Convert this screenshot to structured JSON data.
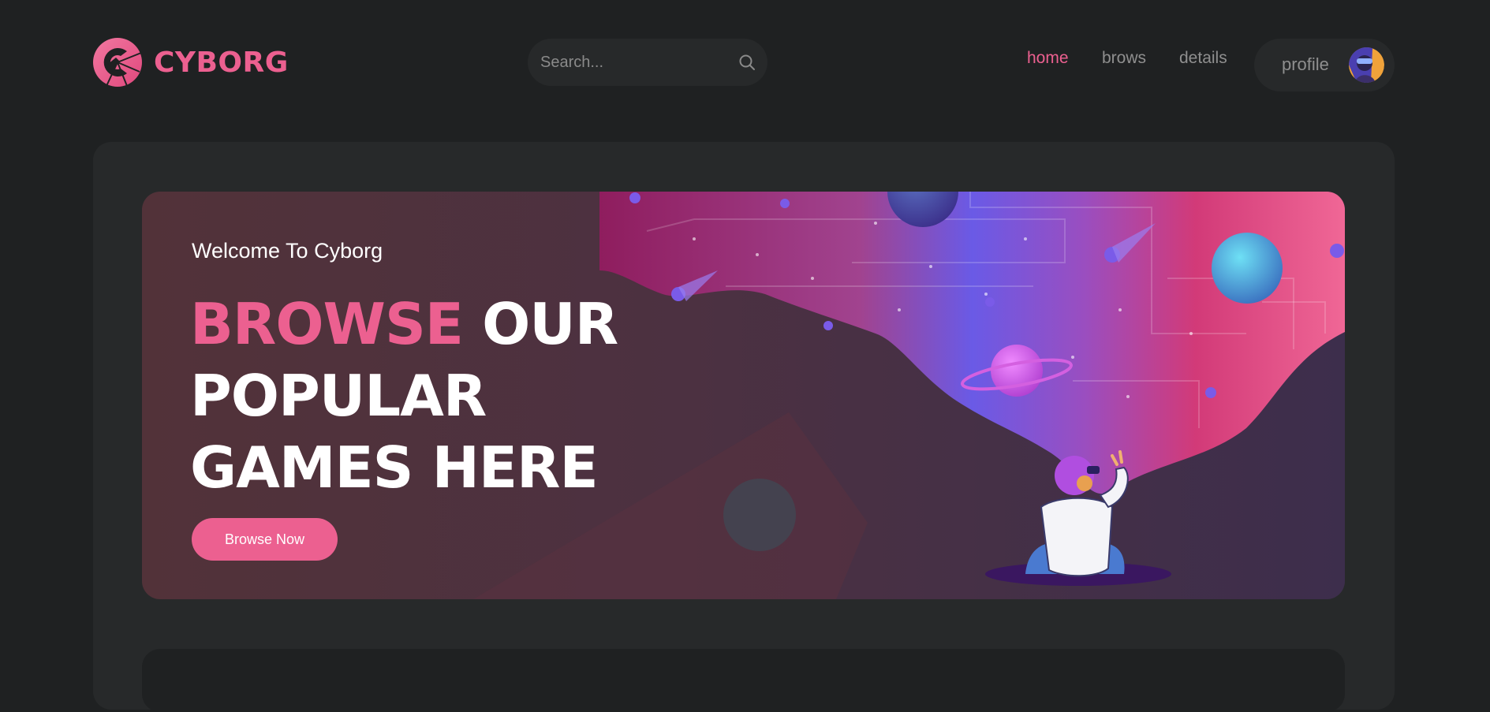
{
  "brand": {
    "name": "CYBORG",
    "accent": "#ec6090"
  },
  "search": {
    "placeholder": "Search...",
    "value": ""
  },
  "nav": {
    "items": [
      {
        "label": "home",
        "active": true
      },
      {
        "label": "brows",
        "active": false
      },
      {
        "label": "details",
        "active": false
      }
    ],
    "profile_label": "profile"
  },
  "banner": {
    "welcome": "Welcome To Cyborg",
    "headline_highlight": "BROWSE",
    "headline_rest_1": "OUR",
    "headline_line_2": "POPULAR",
    "headline_line_3": "GAMES HERE",
    "button_label": "Browse Now"
  },
  "colors": {
    "background": "#1f2122",
    "panel": "#27292a",
    "accent": "#ec6090",
    "text": "#ffffff",
    "muted": "#8f8f8f"
  },
  "icons": [
    "logo-icon",
    "search-icon",
    "avatar"
  ]
}
